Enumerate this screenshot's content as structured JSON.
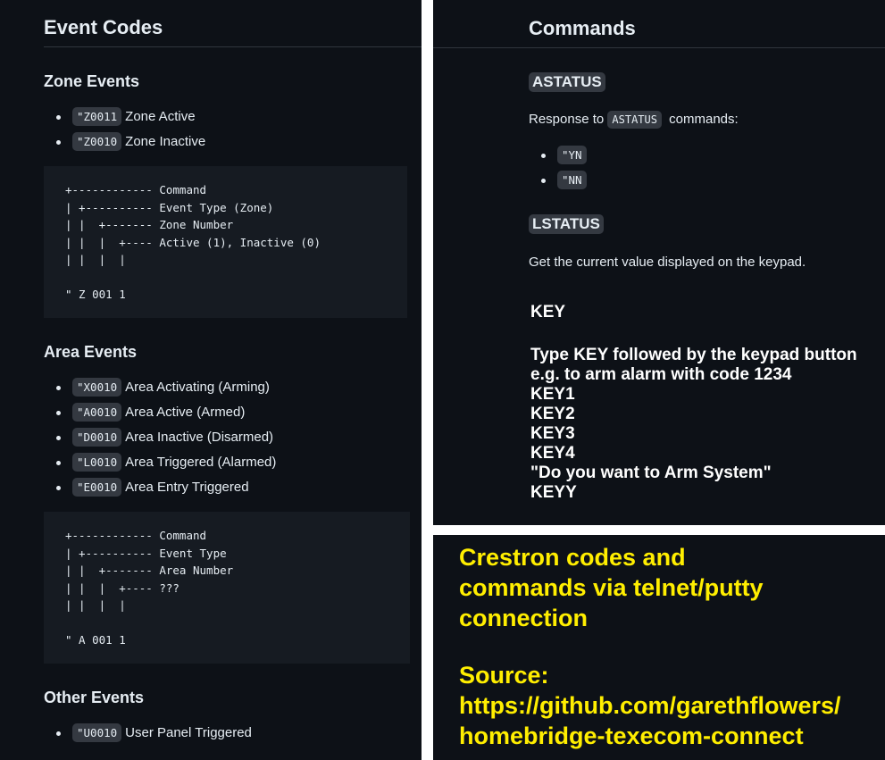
{
  "left": {
    "title": "Event Codes",
    "zone": {
      "heading": "Zone Events",
      "items": [
        {
          "code": "\"Z0011",
          "label": "Zone Active"
        },
        {
          "code": "\"Z0010",
          "label": "Zone Inactive"
        }
      ],
      "diagram": "+------------ Command\n| +---------- Event Type (Zone)\n| |  +------- Zone Number\n| |  |  +---- Active (1), Inactive (0)\n| |  |  |\n\n\" Z 001 1"
    },
    "area": {
      "heading": "Area Events",
      "items": [
        {
          "code": "\"X0010",
          "label": "Area Activating (Arming)"
        },
        {
          "code": "\"A0010",
          "label": "Area Active (Armed)"
        },
        {
          "code": "\"D0010",
          "label": "Area Inactive (Disarmed)"
        },
        {
          "code": "\"L0010",
          "label": "Area Triggered (Alarmed)"
        },
        {
          "code": "\"E0010",
          "label": "Area Entry Triggered"
        }
      ],
      "diagram": "+------------ Command\n| +---------- Event Type\n| |  +------- Area Number\n| |  |  +---- ???\n| |  |  |\n\n\" A 001 1"
    },
    "other": {
      "heading": "Other Events",
      "items": [
        {
          "code": "\"U0010",
          "label": "User Panel Triggered"
        }
      ]
    }
  },
  "right": {
    "title": "Commands",
    "astatus": {
      "heading": "ASTATUS",
      "text_before": "Response to",
      "inline_code": "ASTATUS",
      "text_after": "commands:",
      "items": [
        "\"YN",
        "\"NN"
      ]
    },
    "lstatus": {
      "heading": "LSTATUS",
      "text": "Get the current value displayed on the keypad."
    },
    "key": {
      "heading": "KEY",
      "lines": [
        "Type KEY followed by the keypad button",
        "e.g. to arm alarm with code 1234",
        "KEY1",
        "KEY2",
        "KEY3",
        "KEY4",
        "\"Do you want to Arm System\"",
        "KEYY"
      ]
    }
  },
  "note": {
    "lines1": [
      "Crestron codes and",
      "commands via telnet/putty",
      "connection"
    ],
    "lines2": [
      "Source:",
      "https://github.com/garethflowers/",
      "homebridge-texecom-connect"
    ]
  },
  "colors": {
    "background": "#0d1117",
    "code_block": "#161b22",
    "inline_code": "#343941",
    "text": "#e6edf3",
    "note_text": "#ffee00",
    "separator": "#ffffff"
  }
}
